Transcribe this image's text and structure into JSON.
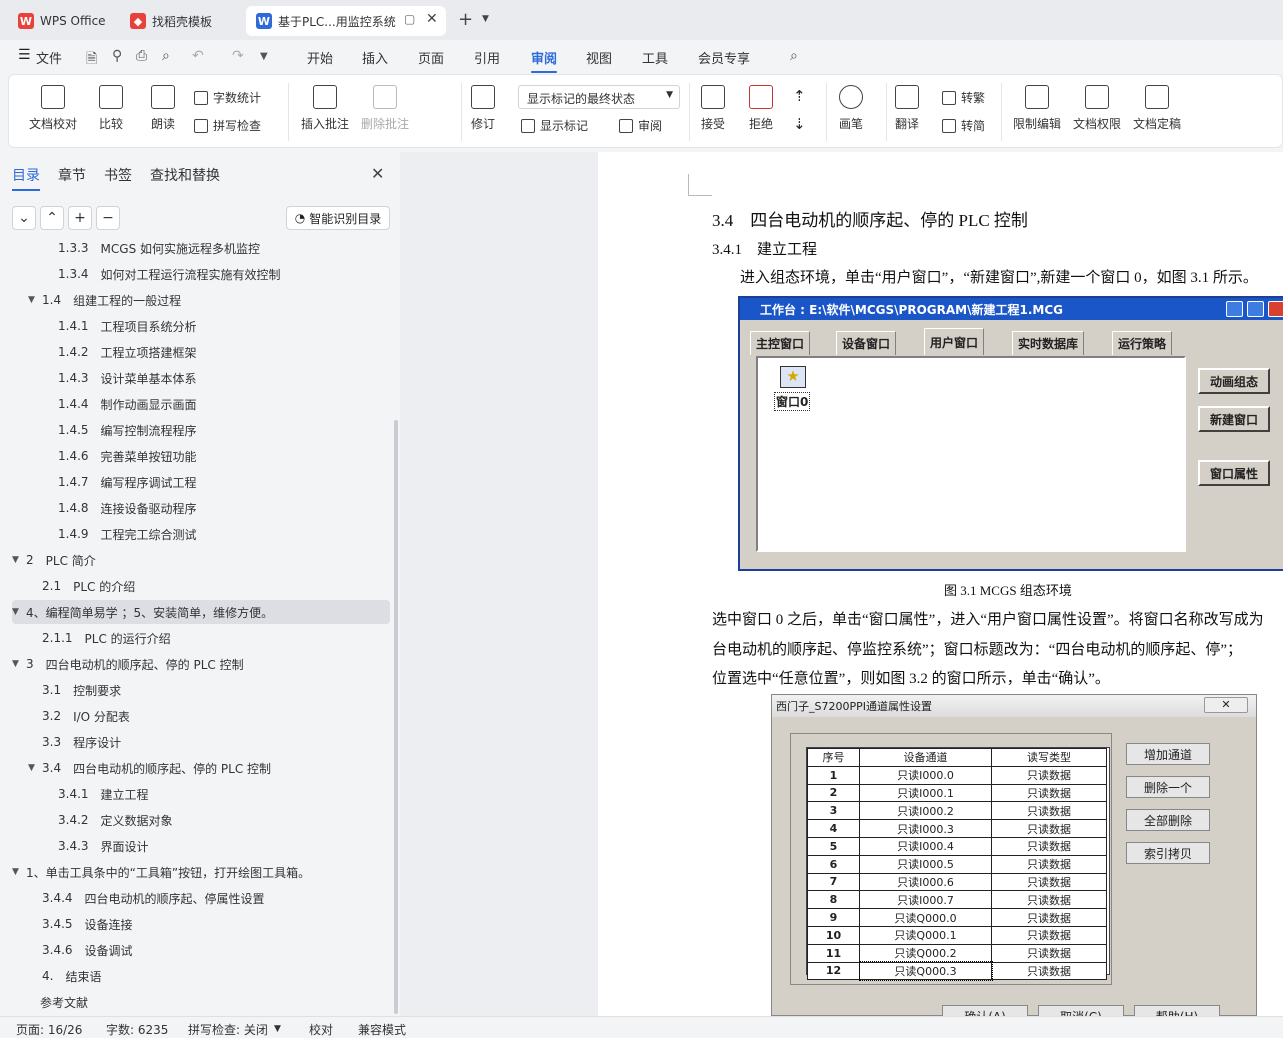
{
  "tabs": [
    {
      "label": "WPS Office",
      "icon": "wps-logo-icon"
    },
    {
      "label": "找稻壳模板",
      "icon": "docer-icon"
    },
    {
      "label": "基于PLC...用监控系统",
      "icon": "word-doc-icon"
    }
  ],
  "menu": {
    "file": "文件",
    "items": [
      "开始",
      "插入",
      "页面",
      "引用",
      "审阅",
      "视图",
      "工具",
      "会员专享"
    ],
    "active": "审阅"
  },
  "ribbon": {
    "doc_check": "文档校对",
    "compare": "比较",
    "read_aloud": "朗读",
    "word_count": "字数统计",
    "spell_check": "拼写检查",
    "insert_comment": "插入批注",
    "delete_comment": "删除批注",
    "revise": "修订",
    "markup_dropdown": "显示标记的最终状态",
    "show_markup": "显示标记",
    "review": "审阅",
    "accept": "接受",
    "reject": "拒绝",
    "pen": "画笔",
    "translate": "翻译",
    "to_traditional": "转繁",
    "to_simplified": "转简",
    "restrict_edit": "限制编辑",
    "doc_permission": "文档权限",
    "doc_finalize": "文档定稿"
  },
  "nav": {
    "tabs": [
      "目录",
      "章节",
      "书签",
      "查找和替换"
    ],
    "smart_button": "智能识别目录",
    "toc": [
      {
        "num": "1.3.3",
        "text": "MCGS 如何实施远程多机监控",
        "level": 3
      },
      {
        "num": "1.3.4",
        "text": "如何对工程运行流程实施有效控制",
        "level": 3
      },
      {
        "num": "1.4",
        "text": "组建工程的一般过程",
        "level": 2,
        "expand": true
      },
      {
        "num": "1.4.1",
        "text": "工程项目系统分析",
        "level": 3
      },
      {
        "num": "1.4.2",
        "text": "工程立项搭建框架",
        "level": 3
      },
      {
        "num": "1.4.3",
        "text": "设计菜单基本体系",
        "level": 3
      },
      {
        "num": "1.4.4",
        "text": "制作动画显示画面",
        "level": 3
      },
      {
        "num": "1.4.5",
        "text": "编写控制流程程序",
        "level": 3
      },
      {
        "num": "1.4.6",
        "text": "完善菜单按钮功能",
        "level": 3
      },
      {
        "num": "1.4.7",
        "text": "编写程序调试工程",
        "level": 3
      },
      {
        "num": "1.4.8",
        "text": "连接设备驱动程序",
        "level": 3
      },
      {
        "num": "1.4.9",
        "text": "工程完工综合测试",
        "level": 3
      },
      {
        "num": "2",
        "text": "PLC 简介",
        "level": 1,
        "expand": true
      },
      {
        "num": "2.1",
        "text": "PLC 的介绍",
        "level": 2
      },
      {
        "num": "",
        "text": "4、编程简单易学 ；5、安装简单，维修方便。",
        "level": 1,
        "expand": true,
        "highlight": true
      },
      {
        "num": "2.1.1",
        "text": "PLC 的运行介绍",
        "level": 2
      },
      {
        "num": "3",
        "text": "四台电动机的顺序起、停的 PLC 控制",
        "level": 1,
        "expand": true
      },
      {
        "num": "3.1",
        "text": "控制要求",
        "level": 2
      },
      {
        "num": "3.2",
        "text": "I/O 分配表",
        "level": 2
      },
      {
        "num": "3.3",
        "text": "程序设计",
        "level": 2
      },
      {
        "num": "3.4",
        "text": "四台电动机的顺序起、停的 PLC 控制",
        "level": 2,
        "expand": true
      },
      {
        "num": "3.4.1",
        "text": "建立工程",
        "level": 3
      },
      {
        "num": "3.4.2",
        "text": "定义数据对象",
        "level": 3
      },
      {
        "num": "3.4.3",
        "text": "界面设计",
        "level": 3
      },
      {
        "num": "",
        "text": "1、单击工具条中的“工具箱”按钮，打开绘图工具箱。",
        "level": 1,
        "expand": true
      },
      {
        "num": "3.4.4",
        "text": "四台电动机的顺序起、停属性设置",
        "level": 2
      },
      {
        "num": "3.4.5",
        "text": "设备连接",
        "level": 2
      },
      {
        "num": "3.4.6",
        "text": "设备调试",
        "level": 2
      },
      {
        "num": "4.",
        "text": "结束语",
        "level": 2
      },
      {
        "num": "",
        "text": "参考文献",
        "level": 0
      }
    ]
  },
  "document": {
    "heading_34": "3.4　四台电动机的顺序起、停的 PLC 控制",
    "heading_341": "3.4.1　建立工程",
    "para1": "进入组态环境，单击“用户窗口”，“新建窗口”,新建一个窗口 0，如图 3.1 所示。",
    "caption": "图  3.1 MCGS 组态环境",
    "para2_l1": "选中窗口 0 之后，单击“窗口属性”，进入“用户窗口属性设置”。将窗口名称改写成为",
    "para2_l2": "台电动机的顺序起、停监控系统”；窗口标题改为：“四台电动机的顺序起、停”；",
    "para2_l3": "位置选中“任意位置”，则如图 3.2 的窗口所示，单击“确认”。",
    "win1": {
      "title": "工作台 : E:\\软件\\MCGS\\PROGRAM\\新建工程1.MCG",
      "tabs": [
        "主控窗口",
        "设备窗口",
        "用户窗口",
        "实时数据库",
        "运行策略"
      ],
      "window_item": "窗口0",
      "buttons": [
        "动画组态",
        "新建窗口",
        "窗口属性"
      ]
    },
    "win2": {
      "title": "西门子_S7200PPI通道属性设置",
      "columns": [
        "序号",
        "设备通道",
        "读写类型"
      ],
      "rows": [
        [
          "1",
          "只读I000.0",
          "只读数据"
        ],
        [
          "2",
          "只读I000.1",
          "只读数据"
        ],
        [
          "3",
          "只读I000.2",
          "只读数据"
        ],
        [
          "4",
          "只读I000.3",
          "只读数据"
        ],
        [
          "5",
          "只读I000.4",
          "只读数据"
        ],
        [
          "6",
          "只读I000.5",
          "只读数据"
        ],
        [
          "7",
          "只读I000.6",
          "只读数据"
        ],
        [
          "8",
          "只读I000.7",
          "只读数据"
        ],
        [
          "9",
          "只读Q000.0",
          "只读数据"
        ],
        [
          "10",
          "只读Q000.1",
          "只读数据"
        ],
        [
          "11",
          "只读Q000.2",
          "只读数据"
        ],
        [
          "12",
          "只读Q000.3",
          "只读数据"
        ]
      ],
      "buttons": [
        "增加通道",
        "删除一个",
        "全部删除",
        "索引拷贝"
      ],
      "bottom_buttons": [
        "确认(A)",
        "取消(C)",
        "帮助(H)"
      ]
    }
  },
  "status": {
    "page": "页面: 16/26",
    "words": "字数: 6235",
    "spell": "拼写检查: 关闭",
    "proof": "校对",
    "compat": "兼容模式"
  },
  "colors": {
    "accent": "#2f6ad9",
    "wps_red": "#e8413a",
    "win_title": "#1a56c7"
  }
}
